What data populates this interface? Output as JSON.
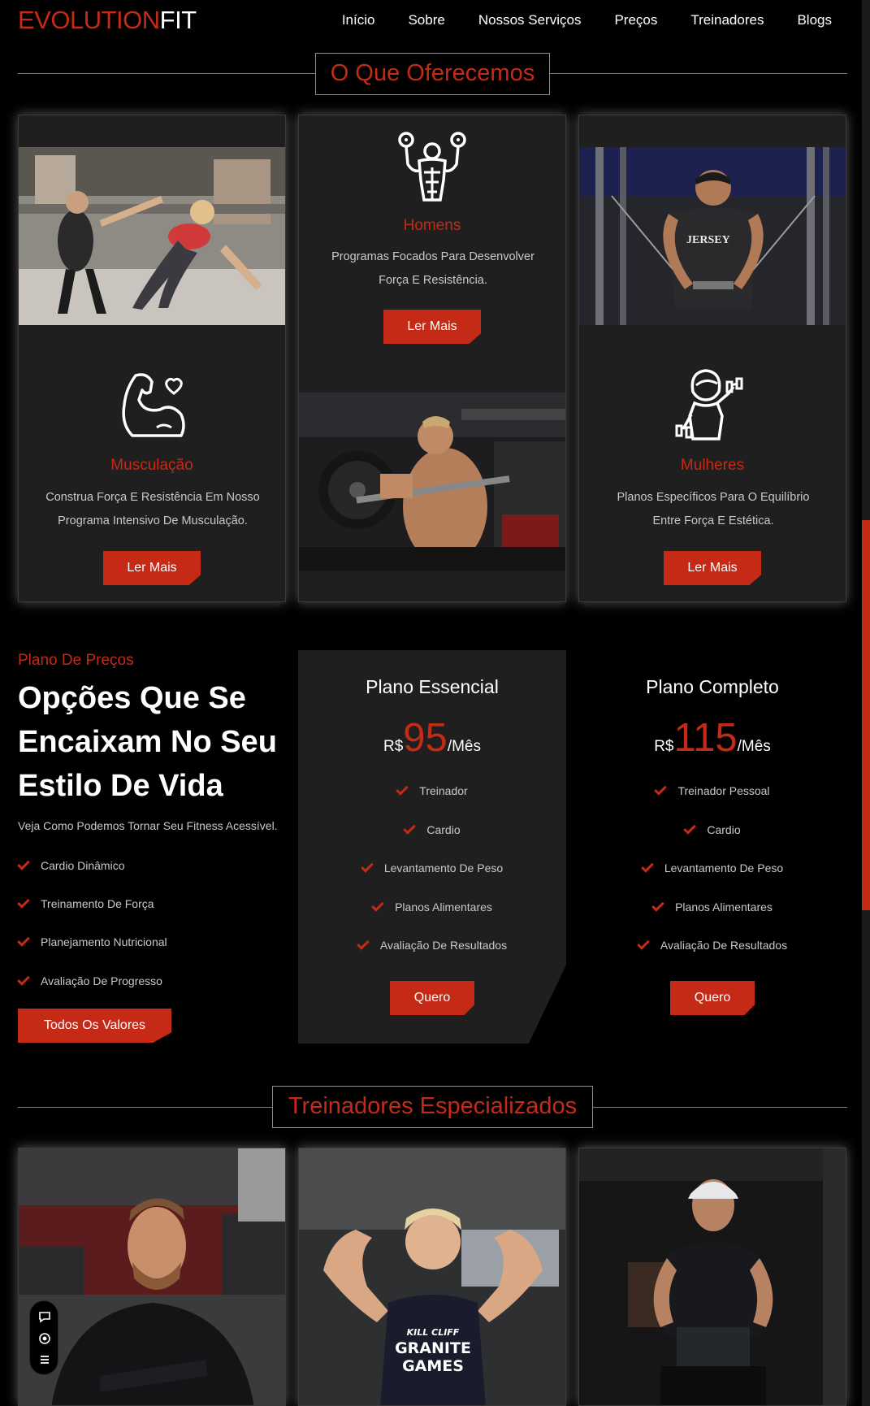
{
  "brand": {
    "part1": "EVOLUTION",
    "part2": "FIT",
    "accent": "#c42a16"
  },
  "nav": {
    "items": [
      {
        "label": "Início"
      },
      {
        "label": "Sobre"
      },
      {
        "label": "Nossos Serviços"
      },
      {
        "label": "Preços"
      },
      {
        "label": "Treinadores"
      },
      {
        "label": "Blogs"
      }
    ]
  },
  "services": {
    "title": "O Que Oferecemos",
    "cards": [
      {
        "title": "Musculação",
        "icon": "bicep-heart-icon",
        "desc": "Construa Força E Resistência Em Nosso Programa Intensivo De Musculação.",
        "button": "Ler Mais"
      },
      {
        "title": "Homens",
        "icon": "bodybuilder-icon",
        "desc": "Programas Focados Para Desenvolver Força E Resistência.",
        "button": "Ler Mais"
      },
      {
        "title": "Mulheres",
        "icon": "woman-dumbbell-icon",
        "desc": "Planos Específicos Para O Equilíbrio Entre Força E Estética.",
        "button": "Ler Mais"
      }
    ]
  },
  "pricing": {
    "kicker": "Plano De Preços",
    "heading": "Opções Que Se Encaixam No Seu Estilo De Vida",
    "subtitle": "Veja Como Podemos Tornar Seu Fitness Acessível.",
    "features": [
      "Cardio Dinâmico",
      "Treinamento De Força",
      "Planejamento Nutricional",
      "Avaliação De Progresso"
    ],
    "cta": "Todos Os Valores",
    "plans": [
      {
        "name": "Plano Essencial",
        "currency": "R$",
        "price": "95",
        "period": "/Mês",
        "features": [
          "Treinador",
          "Cardio",
          "Levantamento De Peso",
          "Planos Alimentares",
          "Avaliação De Resultados"
        ],
        "button": "Quero"
      },
      {
        "name": "Plano Completo",
        "currency": "R$",
        "price": "115",
        "period": "/Mês",
        "features": [
          "Treinador Pessoal",
          "Cardio",
          "Levantamento De Peso",
          "Planos Alimentares",
          "Avaliação De Resultados"
        ],
        "button": "Quero"
      }
    ]
  },
  "trainers": {
    "title": "Treinadores Especializados",
    "shirt_text": [
      "KILL CLIFF",
      "GRANITE",
      "GAMES"
    ]
  },
  "photo_texts": {
    "jersey": "JERSEY"
  }
}
